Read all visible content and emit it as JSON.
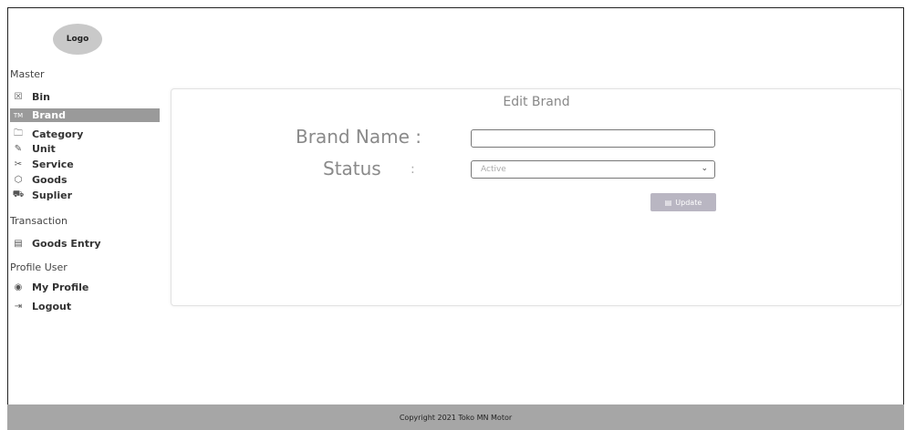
{
  "logo": {
    "text": "Logo"
  },
  "sidebar": {
    "master_title": "Master",
    "master_items": [
      {
        "label": "Bin",
        "icon": "bin-icon",
        "glyph": "☒"
      },
      {
        "label": "Brand",
        "icon": "brand-icon",
        "glyph": "TM"
      },
      {
        "label": "Category",
        "icon": "category-icon",
        "glyph": "🗀"
      },
      {
        "label": "Unit",
        "icon": "pen-icon",
        "glyph": "✎"
      },
      {
        "label": "Service",
        "icon": "tools-icon",
        "glyph": "✂"
      },
      {
        "label": "Goods",
        "icon": "box-icon",
        "glyph": "⬡"
      },
      {
        "label": "Suplier",
        "icon": "truck-icon",
        "glyph": "⛟"
      }
    ],
    "transaction_title": "Transaction",
    "transaction_items": [
      {
        "label": "Goods Entry",
        "icon": "clipboard-icon",
        "glyph": "▤"
      }
    ],
    "profile_title": "Profile User",
    "profile_items": [
      {
        "label": "My Profile",
        "icon": "user-icon",
        "glyph": "◉"
      },
      {
        "label": "Logout",
        "icon": "logout-icon",
        "glyph": "⇥"
      }
    ],
    "active_item": "Brand"
  },
  "form": {
    "title": "Edit Brand",
    "brand_name_label": "Brand Name :",
    "brand_name_value": "",
    "status_label": "Status",
    "status_colon": ":",
    "status_value": "Active",
    "update_label": "Update",
    "update_icon": "save-icon"
  },
  "footer": {
    "text": "Copyright 2021 Toko MN Motor"
  },
  "colors": {
    "active_nav": "#9a9a9a",
    "footer_bg": "#a6a6a6",
    "button_bg": "#b9b6c2"
  }
}
